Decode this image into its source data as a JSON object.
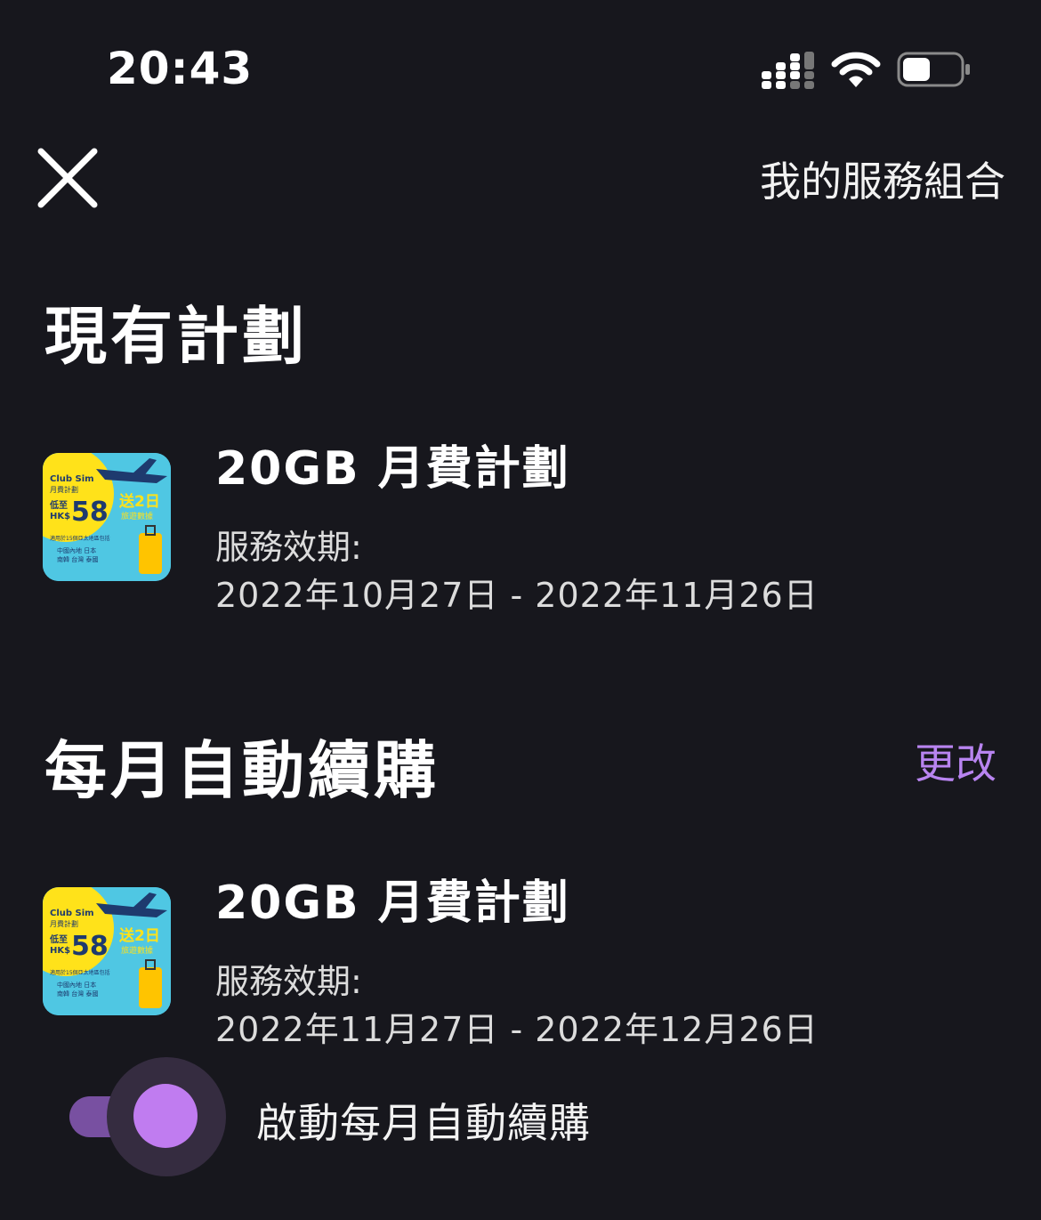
{
  "status_bar": {
    "time": "20:43"
  },
  "header": {
    "title": "我的服務組合"
  },
  "current_plan": {
    "section_title": "現有計劃",
    "plan": {
      "name": "20GB 月費計劃",
      "validity_label": "服務效期:",
      "validity_dates": "2022年10月27日 - 2022年11月26日",
      "thumb": {
        "brand": "Club Sim",
        "subtitle": "月費計劃",
        "low_to": "低至",
        "currency": "HK$",
        "price": "58",
        "promo": "送2日",
        "promo_sub": "旅遊數據",
        "fineprint": "適用於15個亞太地區包括",
        "countries_1": "中國內地 日本",
        "countries_2": "南韓 台灣 泰國"
      }
    }
  },
  "auto_renew": {
    "section_title": "每月自動續購",
    "edit_label": "更改",
    "plan": {
      "name": "20GB 月費計劃",
      "validity_label": "服務效期:",
      "validity_dates": "2022年11月27日 - 2022年12月26日",
      "thumb": {
        "brand": "Club Sim",
        "subtitle": "月費計劃",
        "low_to": "低至",
        "currency": "HK$",
        "price": "58",
        "promo": "送2日",
        "promo_sub": "旅遊數據",
        "fineprint": "適用於15個亞太地區包括",
        "countries_1": "中國內地 日本",
        "countries_2": "南韓 台灣 泰國"
      }
    },
    "toggle_label": "啟動每月自動續購",
    "toggle_on": true
  },
  "colors": {
    "background": "#17171d",
    "accent": "#b884f0",
    "thumb_bg": "#4fc7e3",
    "thumb_yellow": "#ffe21a"
  }
}
